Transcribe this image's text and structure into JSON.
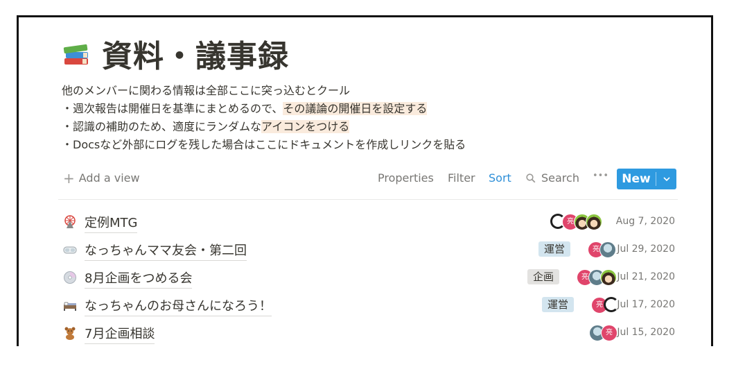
{
  "page": {
    "icon": "books-icon",
    "title": "資料・議事録",
    "description": [
      {
        "parts": [
          {
            "text": "他のメンバーに関わる情報は全部ここに突っ込むとクール",
            "highlight": false
          }
        ]
      },
      {
        "parts": [
          {
            "text": "・週次報告は開催日を基準にまとめるので、",
            "highlight": false
          },
          {
            "text": "その議論の開催日を設定する",
            "highlight": true
          }
        ]
      },
      {
        "parts": [
          {
            "text": "・認識の補助のため、適度にランダムな",
            "highlight": false
          },
          {
            "text": "アイコンをつける",
            "highlight": true
          }
        ]
      },
      {
        "parts": [
          {
            "text": "・Docsなど外部にログを残した場合はここにドキュメントを作成しリンクを貼る",
            "highlight": false
          }
        ]
      }
    ]
  },
  "toolbar": {
    "add_view": "Add a view",
    "properties": "Properties",
    "filter": "Filter",
    "sort": "Sort",
    "search": "Search",
    "more": "•••",
    "new": "New"
  },
  "rows": [
    {
      "icon": "ferris-wheel-icon",
      "name": "定例MTG",
      "tag": "",
      "date": "Aug 7, 2020"
    },
    {
      "icon": "goggles-icon",
      "name": "なっちゃんママ友会・第二回",
      "tag": "運営",
      "date": "Jul 29, 2020"
    },
    {
      "icon": "cd-icon",
      "name": "8月企画をつめる会",
      "tag": "企画",
      "date": "Jul 21, 2020"
    },
    {
      "icon": "bed-icon",
      "name": "なっちゃんのお母さんになろう！",
      "tag": "運営",
      "date": "Jul 17, 2020"
    },
    {
      "icon": "teddy-bear-icon",
      "name": "7月企画相談",
      "tag": "",
      "date": "Jul 15, 2020"
    }
  ],
  "avatar_initial": "亮",
  "colors": {
    "accent": "#2e9ae0",
    "highlight": "#faebdd",
    "tag_blue": "#d3e5ef",
    "tag_gray": "#e3e2e0",
    "avatar_red": "#e0456b"
  }
}
